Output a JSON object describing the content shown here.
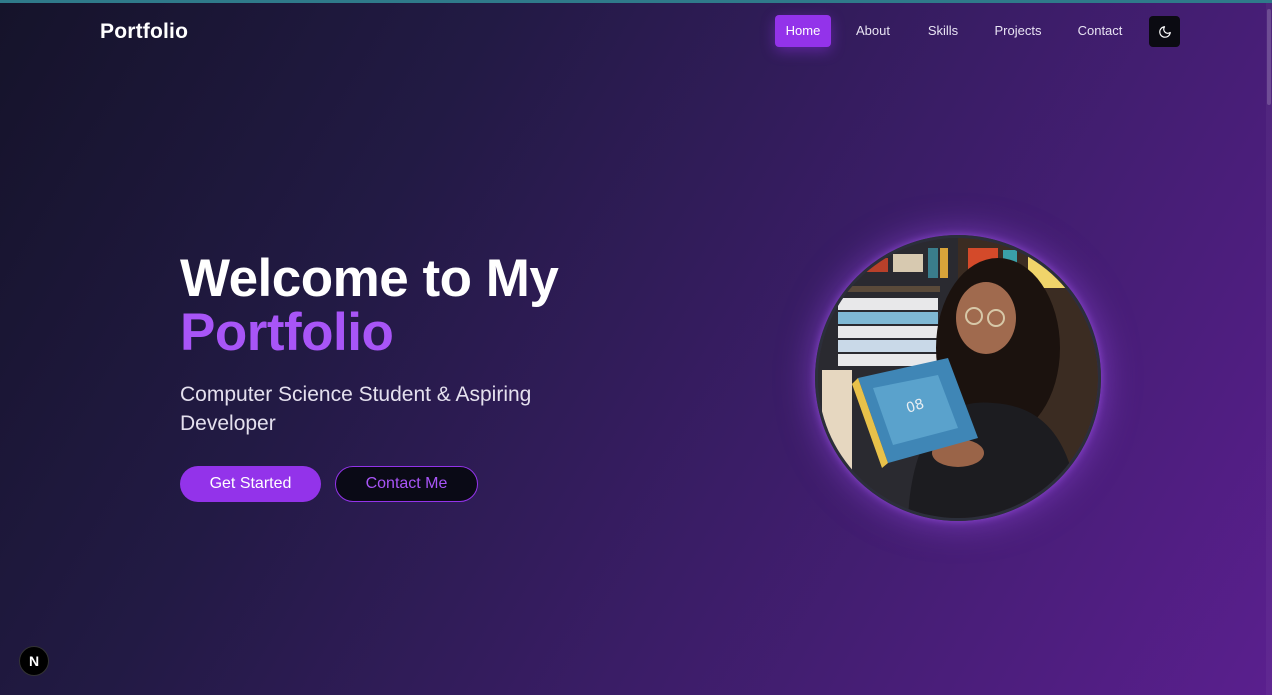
{
  "brand": {
    "logo_text": "Portfolio"
  },
  "nav": {
    "items": [
      {
        "label": "Home",
        "active": true
      },
      {
        "label": "About"
      },
      {
        "label": "Skills"
      },
      {
        "label": "Projects"
      },
      {
        "label": "Contact"
      }
    ],
    "theme_toggle_icon": "moon-icon"
  },
  "hero": {
    "title_line1": "Welcome to My",
    "title_line2": "Portfolio",
    "subtitle": "Computer Science Student & Aspiring Developer",
    "primary_button": "Get Started",
    "secondary_button": "Contact Me",
    "profile_image": "profile-photo"
  },
  "dev_badge": {
    "label": "N"
  },
  "colors": {
    "accent": "#9333ea",
    "accent_text": "#a855f7",
    "background_start": "#15132a",
    "background_end": "#5a1f8e"
  }
}
